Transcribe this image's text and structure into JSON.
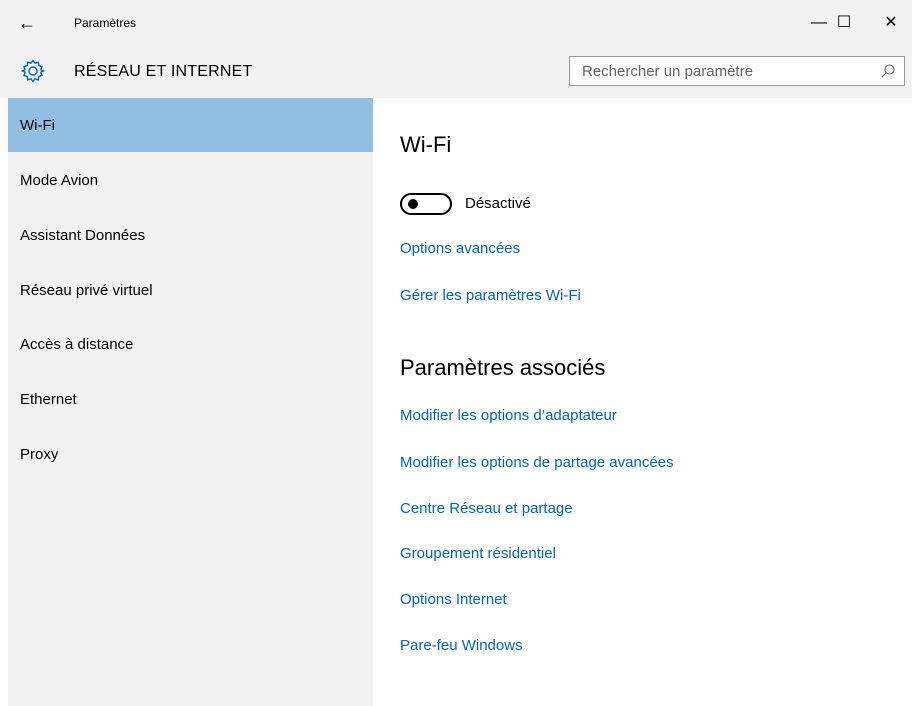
{
  "window": {
    "title": "Paramètres",
    "back_icon": "back-arrow-icon",
    "minimize": "—",
    "maximize": "☐",
    "close": "✕"
  },
  "header": {
    "icon": "gear-icon",
    "title": "RÉSEAU ET INTERNET",
    "search_placeholder": "Rechercher un paramètre",
    "search_icon": "search-icon"
  },
  "sidebar": {
    "selected_index": 0,
    "items": [
      {
        "label": "Wi-Fi"
      },
      {
        "label": "Mode Avion"
      },
      {
        "label": "Assistant Données"
      },
      {
        "label": "Réseau privé virtuel"
      },
      {
        "label": "Accès à distance"
      },
      {
        "label": "Ethernet"
      },
      {
        "label": "Proxy"
      }
    ]
  },
  "main": {
    "heading": "Wi-Fi",
    "toggle": {
      "state": "off",
      "label": "Désactivé"
    },
    "links": [
      {
        "label": "Options avancées"
      },
      {
        "label": "Gérer les paramètres Wi-Fi"
      }
    ],
    "related_heading": "Paramètres associés",
    "related_links": [
      {
        "label": "Modifier les options d’adaptateur"
      },
      {
        "label": "Modifier les options de partage avancées"
      },
      {
        "label": "Centre Réseau et partage"
      },
      {
        "label": "Groupement résidentiel"
      },
      {
        "label": "Options Internet"
      },
      {
        "label": "Pare-feu Windows"
      }
    ]
  },
  "colors": {
    "accent": "#0067b8",
    "selected_bg": "#91bfe3",
    "chrome_bg": "#f2f2f2"
  }
}
